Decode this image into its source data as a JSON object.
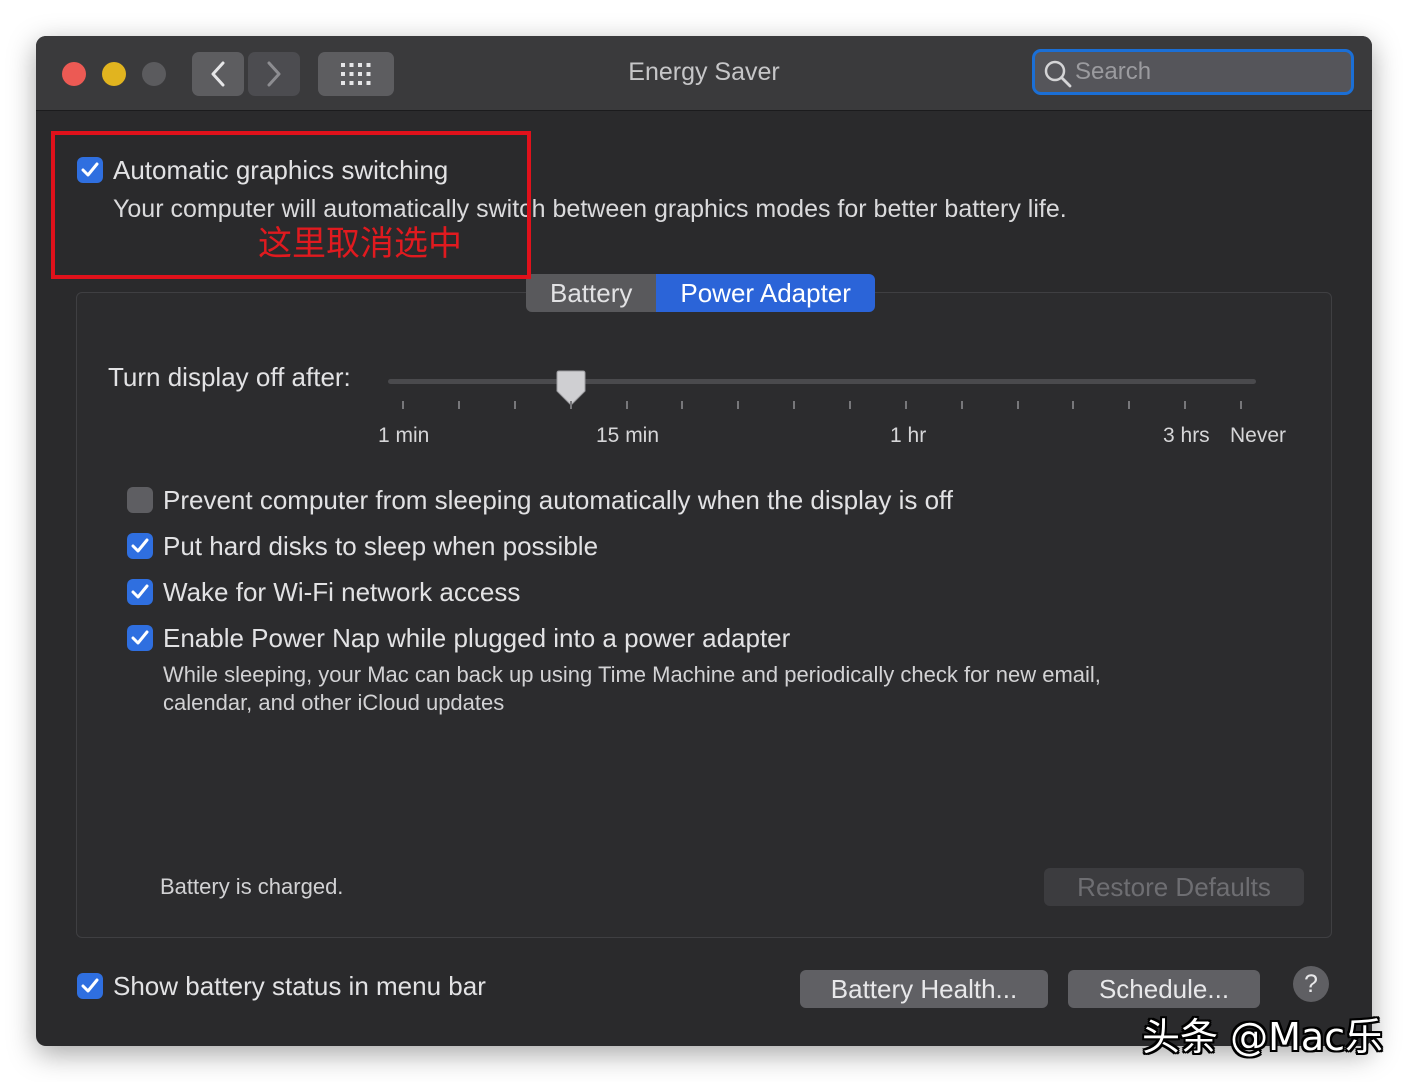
{
  "window": {
    "title": "Energy Saver"
  },
  "search": {
    "placeholder": "Search",
    "value": ""
  },
  "top_option": {
    "label": "Automatic graphics switching",
    "checked": true,
    "description": "Your computer will automatically switch between graphics modes for better battery life."
  },
  "annotation": {
    "text": "这里取消选中",
    "color": "#e0111b"
  },
  "tabs": [
    {
      "label": "Battery",
      "selected": false
    },
    {
      "label": "Power Adapter",
      "selected": true
    }
  ],
  "slider": {
    "label": "Turn display off after:",
    "value": "15 min",
    "ticks": [
      "1 min",
      "15 min",
      "1 hr",
      "3 hrs",
      "Never"
    ]
  },
  "options": [
    {
      "label": "Prevent computer from sleeping automatically when the display is off",
      "checked": false
    },
    {
      "label": "Put hard disks to sleep when possible",
      "checked": true
    },
    {
      "label": "Wake for Wi-Fi network access",
      "checked": true
    },
    {
      "label": "Enable Power Nap while plugged into a power adapter",
      "checked": true,
      "description": "While sleeping, your Mac can back up using Time Machine and periodically check for new email, calendar, and other iCloud updates"
    }
  ],
  "status": {
    "text": "Battery is charged."
  },
  "buttons": {
    "restore_defaults": "Restore Defaults",
    "battery_health": "Battery Health...",
    "schedule": "Schedule...",
    "help": "?"
  },
  "bottom_option": {
    "label": "Show battery status in menu bar",
    "checked": true
  },
  "watermark": {
    "text": "头条 @Mac乐"
  },
  "colors": {
    "accent": "#2f6fe0",
    "highlight_box": "#e0111b",
    "search_focus": "#1b6fd6"
  }
}
